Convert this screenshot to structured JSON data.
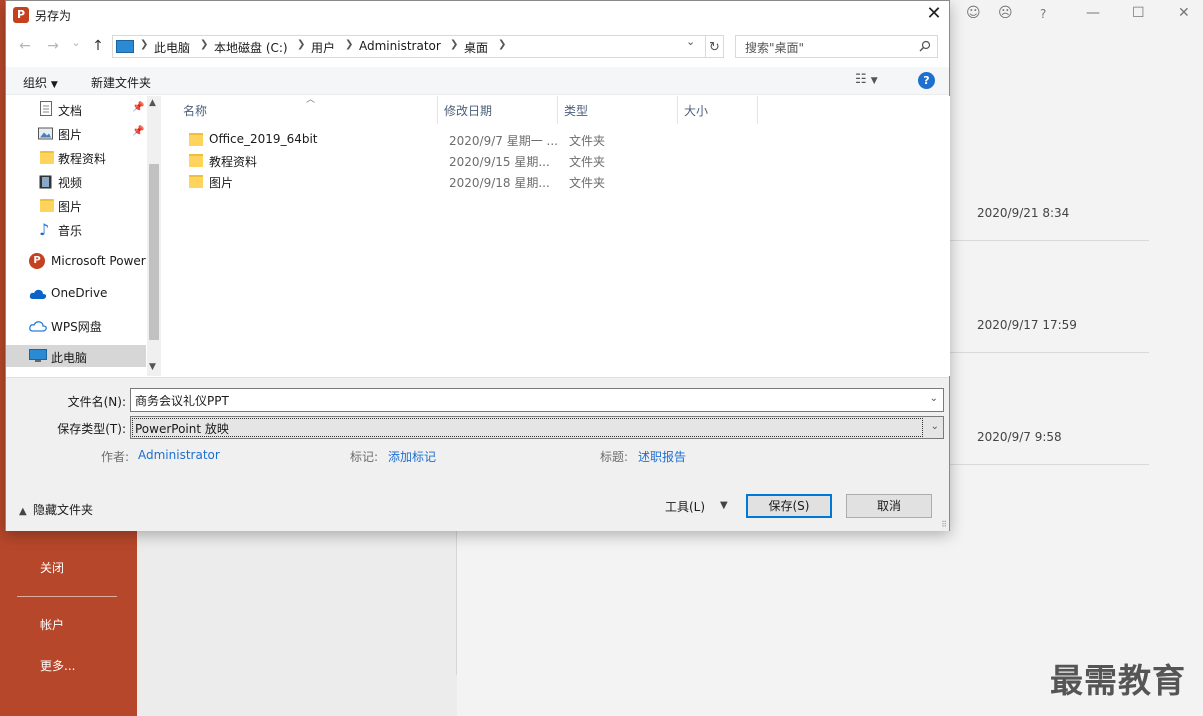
{
  "dialog": {
    "title": "另存为",
    "app_icon_letter": "P",
    "close_glyph": "✕"
  },
  "nav": {
    "back_glyph": "←",
    "forward_glyph": "→",
    "recent_glyph": "⌄",
    "up_glyph": "↑",
    "breadcrumbs": [
      "此电脑",
      "本地磁盘 (C:)",
      "用户",
      "Administrator",
      "桌面"
    ],
    "search_placeholder": "搜索\"桌面\""
  },
  "toolbar": {
    "organize": "组织",
    "new_folder": "新建文件夹",
    "help": "?"
  },
  "nav_pane": {
    "items": [
      {
        "label": "文档",
        "icon": "document-icon",
        "pinned": true
      },
      {
        "label": "图片",
        "icon": "pictures-icon",
        "pinned": true
      },
      {
        "label": "教程资料",
        "icon": "folder-icon",
        "pinned": false
      },
      {
        "label": "视频",
        "icon": "video-icon",
        "pinned": false
      },
      {
        "label": "图片",
        "icon": "folder-icon",
        "pinned": false
      },
      {
        "label": "音乐",
        "icon": "music-icon",
        "pinned": false
      },
      {
        "label": "Microsoft Power",
        "icon": "powerpoint-icon"
      },
      {
        "label": "OneDrive",
        "icon": "onedrive-icon"
      },
      {
        "label": "WPS网盘",
        "icon": "wps-cloud-icon"
      },
      {
        "label": "此电脑",
        "icon": "this-pc-icon",
        "selected": true
      }
    ]
  },
  "files": {
    "columns": [
      "名称",
      "修改日期",
      "类型",
      "大小"
    ],
    "rows": [
      {
        "name": "Office_2019_64bit",
        "date": "2020/9/7 星期一 ...",
        "type": "文件夹"
      },
      {
        "name": "教程资料",
        "date": "2020/9/15 星期...",
        "type": "文件夹"
      },
      {
        "name": "图片",
        "date": "2020/9/18 星期...",
        "type": "文件夹"
      }
    ]
  },
  "form": {
    "filename_label": "文件名(N):",
    "filename_value": "商务会议礼仪PPT",
    "filetype_label": "保存类型(T):",
    "filetype_value": "PowerPoint 放映",
    "author_label": "作者:",
    "author_value": "Administrator",
    "tags_label": "标记:",
    "tags_value": "添加标记",
    "title_label": "标题:",
    "title_value": "述职报告"
  },
  "footer": {
    "hide_folders": "隐藏文件夹",
    "tools": "工具(L)",
    "save": "保存(S)",
    "cancel": "取消"
  },
  "background": {
    "left_menu": [
      "关闭",
      "帐户",
      "更多..."
    ],
    "recent_dates": [
      "2020/9/21 8:34",
      "2020/9/17 17:59",
      "2020/9/7 9:58"
    ],
    "watermark": "最需教育",
    "accent_color": "#b7472a"
  }
}
